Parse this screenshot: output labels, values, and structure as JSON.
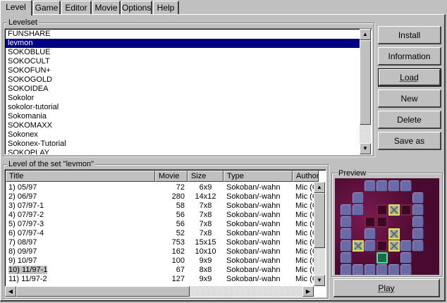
{
  "tabs": [
    {
      "label": "Level",
      "active": true
    },
    {
      "label": "Game",
      "active": false
    },
    {
      "label": "Editor",
      "active": false
    },
    {
      "label": "Movie",
      "active": false
    },
    {
      "label": "Options",
      "active": false
    },
    {
      "label": "Help",
      "active": false
    }
  ],
  "levelset": {
    "group_label": "Levelset",
    "items": [
      "FUNSHARE",
      "levmon",
      "SOKOBLUE",
      "SOKOCULT",
      "SOKOFUN+",
      "SOKOGOLD",
      "SOKOIDEA",
      "Sokolor",
      "sokolor-tutorial",
      "Sokomania",
      "SOKOMAXX",
      "Sokonex",
      "Sokonex-Tutorial",
      "SOKOPLAY"
    ],
    "selected_index": 1
  },
  "buttons": {
    "install": "Install",
    "information": "Information",
    "load": "Load",
    "new": "New",
    "delete": "Delete",
    "save_as": "Save as",
    "play": "Play"
  },
  "levels": {
    "group_label": "Level of the set \"levmon\"",
    "columns": [
      "Title",
      "Movie",
      "Size",
      "Type",
      "Author"
    ],
    "rows": [
      [
        "1) 05/97",
        "72",
        "6x9",
        "Sokoban/-wahn",
        "Mic (G"
      ],
      [
        "2) 06/97",
        "280",
        "14x12",
        "Sokoban/-wahn",
        "Mic (G"
      ],
      [
        "3) 07/97-1",
        "58",
        "7x8",
        "Sokoban/-wahn",
        "Mic (G"
      ],
      [
        "4) 07/97-2",
        "56",
        "7x8",
        "Sokoban/-wahn",
        "Mic (G"
      ],
      [
        "5) 07/97-3",
        "56",
        "7x8",
        "Sokoban/-wahn",
        "Mic (G"
      ],
      [
        "6) 07/97-4",
        "52",
        "7x8",
        "Sokoban/-wahn",
        "Mic (G"
      ],
      [
        "7) 08/97",
        "753",
        "15x15",
        "Sokoban/-wahn",
        "Mic (G"
      ],
      [
        "8) 09/97",
        "162",
        "10x10",
        "Sokoban/-wahn",
        "Mic (G"
      ],
      [
        "9) 10/97",
        "100",
        "9x9",
        "Sokoban/-wahn",
        "Mic (G"
      ],
      [
        "10) 11/97-1",
        "67",
        "8x8",
        "Sokoban/-wahn",
        "Mic (G"
      ],
      [
        "11) 11/97-2",
        "127",
        "9x9",
        "Sokoban/-wahn",
        "Mic (G"
      ]
    ],
    "selected_index": 9
  },
  "preview": {
    "group_label": "Preview",
    "colors": {
      "background": "#5a1038",
      "wall": "#6a6aa6",
      "goal": "#7a2048",
      "box_border": "#e0e060",
      "player": "#1a6a4a"
    }
  }
}
